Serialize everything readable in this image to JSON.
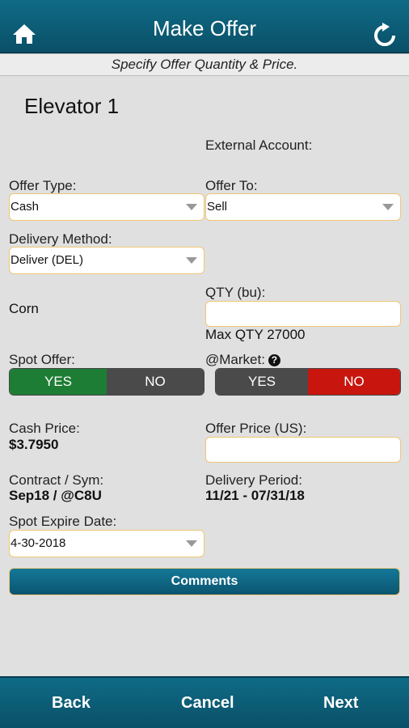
{
  "header": {
    "title": "Make Offer",
    "home_icon": "home-icon",
    "refresh_icon": "refresh-icon"
  },
  "subtitle": "Specify Offer Quantity & Price.",
  "elevator": "Elevator 1",
  "external_account": {
    "label": "External Account:"
  },
  "offer_type": {
    "label": "Offer Type:",
    "value": "Cash"
  },
  "offer_to": {
    "label": "Offer To:",
    "value": "Sell"
  },
  "delivery_method": {
    "label": "Delivery Method:",
    "value": "Deliver (DEL)"
  },
  "commodity": "Corn",
  "qty": {
    "label": "QTY (bu):",
    "value": "",
    "max_text": "Max QTY 27000"
  },
  "spot_offer": {
    "label": "Spot Offer:",
    "yes": "YES",
    "no": "NO",
    "selected": "YES"
  },
  "at_market": {
    "label": "@Market:",
    "help_icon": "?",
    "yes": "YES",
    "no": "NO",
    "selected": "NO"
  },
  "cash_price": {
    "label": "Cash Price:",
    "value": "$3.7950"
  },
  "offer_price": {
    "label": "Offer Price (US):",
    "value": ""
  },
  "contract": {
    "label": "Contract / Sym:",
    "value": "Sep18 / @C8U"
  },
  "delivery_period": {
    "label": "Delivery Period:",
    "value": "11/21 - 07/31/18"
  },
  "spot_expire": {
    "label": "Spot Expire Date:",
    "value": "4-30-2018"
  },
  "comments_label": "Comments",
  "footer": {
    "back": "Back",
    "cancel": "Cancel",
    "next": "Next"
  },
  "colors": {
    "header": "#0f6b86",
    "yes_active": "#1e7d34",
    "no_active": "#c8160f",
    "inactive": "#4a4a4a",
    "field_border": "#f0c674"
  }
}
